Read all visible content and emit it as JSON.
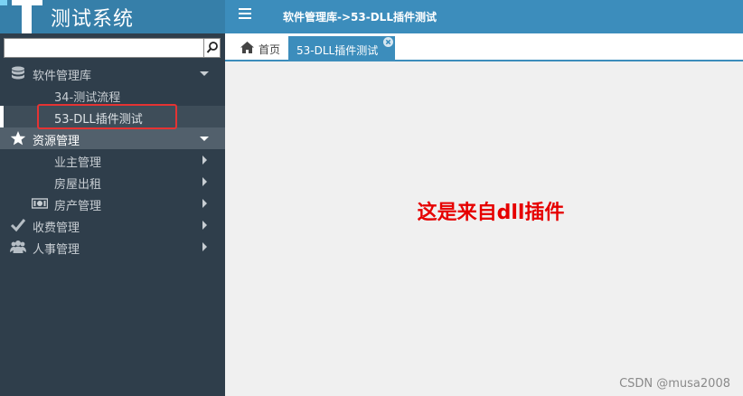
{
  "app": {
    "title": "测试系统"
  },
  "header": {
    "breadcrumb": "软件管理库->53-DLL插件测试",
    "menu_icon": "hamburger-icon"
  },
  "search": {
    "placeholder": "",
    "value": ""
  },
  "sidebar": {
    "items": [
      {
        "label": "软件管理库",
        "icon": "database-icon"
      },
      {
        "label": "34-测试流程"
      },
      {
        "label": "53-DLL插件测试"
      },
      {
        "label": "资源管理",
        "icon": "star-icon"
      },
      {
        "label": "业主管理"
      },
      {
        "label": "房屋出租"
      },
      {
        "label": "房产管理",
        "icon": "money-icon"
      },
      {
        "label": "收费管理",
        "icon": "check-icon"
      },
      {
        "label": "人事管理",
        "icon": "users-icon"
      }
    ]
  },
  "tabs": {
    "home": "首页",
    "active": "53-DLL插件测试"
  },
  "main": {
    "message": "这是来自dll插件"
  },
  "watermark": "CSDN @musa2008",
  "colors": {
    "header": "#3c8dbc",
    "sidebar": "#2f3e4b",
    "message": "#e60000",
    "highlight": "#e53333"
  }
}
